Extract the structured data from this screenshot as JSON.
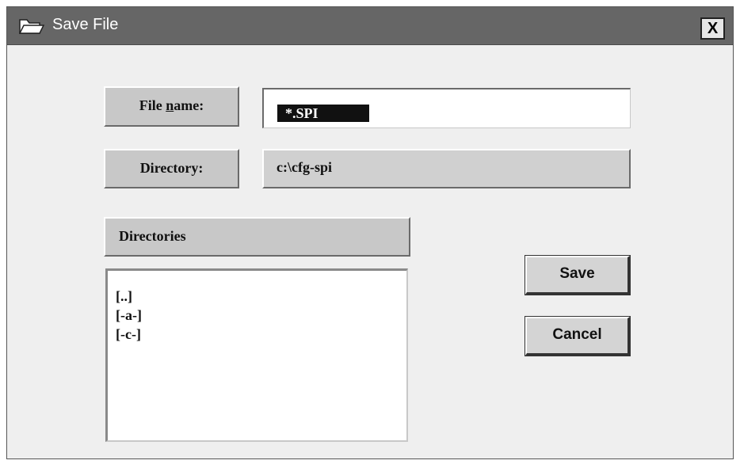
{
  "window": {
    "title": "Save File",
    "close_label": "X"
  },
  "file_name": {
    "label_before": "File ",
    "label_mnemonic": "n",
    "label_after": "ame:",
    "value": "*.SPI"
  },
  "directory": {
    "label": "Directory:",
    "value": "c:\\cfg-spi"
  },
  "directories": {
    "header": "Directories",
    "items": [
      "[..]",
      "[-a-]",
      "[-c-]"
    ]
  },
  "buttons": {
    "save": "Save",
    "cancel": "Cancel"
  },
  "colors": {
    "titlebar": "#666666",
    "panel": "#efefef",
    "label_bg": "#c8c8c8",
    "selection": "#111111"
  },
  "icons": {
    "title": "folder-open-icon",
    "close": "close-icon"
  }
}
